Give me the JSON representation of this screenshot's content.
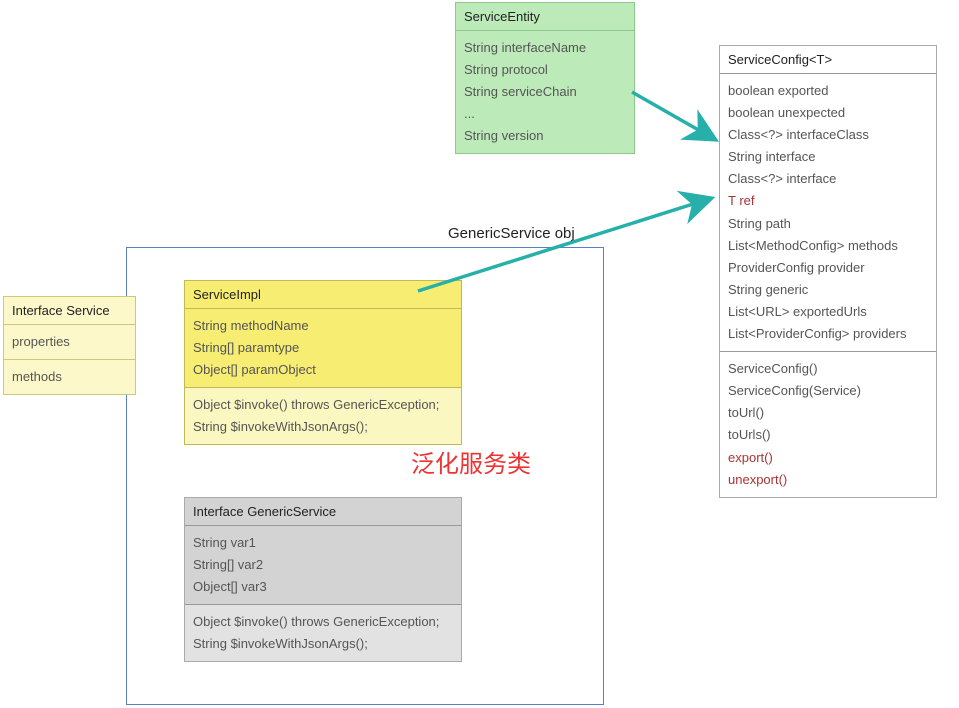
{
  "serviceEntity": {
    "title": "ServiceEntity",
    "fields": [
      "String interfaceName",
      "String protocol",
      "String serviceChain",
      "...",
      "String version"
    ]
  },
  "serviceConfig": {
    "title": "ServiceConfig<T>",
    "fields": [
      {
        "t": "boolean exported"
      },
      {
        "t": "boolean unexpected"
      },
      {
        "t": "Class<?> interfaceClass"
      },
      {
        "t": "String interface"
      },
      {
        "t": "Class<?> interface"
      },
      {
        "t": "T ref",
        "hl": true
      },
      {
        "t": "String path"
      },
      {
        "t": "List<MethodConfig> methods"
      },
      {
        "t": "ProviderConfig provider"
      },
      {
        "t": "String generic"
      },
      {
        "t": "List<URL> exportedUrls"
      },
      {
        "t": "List<ProviderConfig> providers"
      }
    ],
    "methods": [
      {
        "t": "ServiceConfig()"
      },
      {
        "t": "ServiceConfig(Service)"
      },
      {
        "t": "toUrl()"
      },
      {
        "t": "toUrls()"
      },
      {
        "t": "export()",
        "hl": true
      },
      {
        "t": "unexport()",
        "hl": true
      }
    ]
  },
  "interfaceService": {
    "title": "Interface Service",
    "row1": "properties",
    "row2": "methods"
  },
  "serviceImpl": {
    "title": "ServiceImpl",
    "fields": [
      "String methodName",
      "String[] paramtype",
      "Object[] paramObject"
    ],
    "methods": [
      "Object $invoke() throws GenericException;",
      "String $invokeWithJsonArgs();"
    ]
  },
  "genericService": {
    "title": "Interface GenericService",
    "fields": [
      "String var1",
      "String[] var2",
      "Object[] var3"
    ],
    "methods": [
      "Object $invoke() throws GenericException;",
      "String $invokeWithJsonArgs();"
    ]
  },
  "labels": {
    "genericObj": "GenericService obj",
    "chinese": "泛化服务类"
  }
}
